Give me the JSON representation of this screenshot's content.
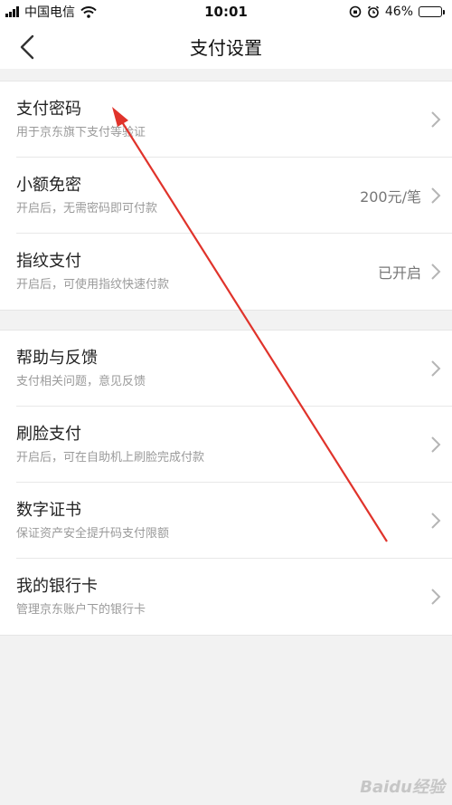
{
  "status": {
    "carrier": "中国电信",
    "time": "10:01",
    "battery": "46%",
    "battery_level": 0.46
  },
  "nav": {
    "title": "支付设置"
  },
  "groups": [
    {
      "items": [
        {
          "title": "支付密码",
          "sub": "用于京东旗下支付等验证",
          "value": ""
        },
        {
          "title": "小额免密",
          "sub": "开启后，无需密码即可付款",
          "value": "200元/笔"
        },
        {
          "title": "指纹支付",
          "sub": "开启后，可使用指纹快速付款",
          "value": "已开启"
        }
      ]
    },
    {
      "items": [
        {
          "title": "帮助与反馈",
          "sub": "支付相关问题，意见反馈",
          "value": ""
        },
        {
          "title": "刷脸支付",
          "sub": "开启后，可在自助机上刷脸完成付款",
          "value": ""
        },
        {
          "title": "数字证书",
          "sub": "保证资产安全提升码支付限额",
          "value": ""
        },
        {
          "title": "我的银行卡",
          "sub": "管理京东账户下的银行卡",
          "value": ""
        }
      ]
    }
  ],
  "watermark": "Baidu经验",
  "colors": {
    "annotation_arrow": "#e0332b",
    "background": "#f2f2f2"
  }
}
